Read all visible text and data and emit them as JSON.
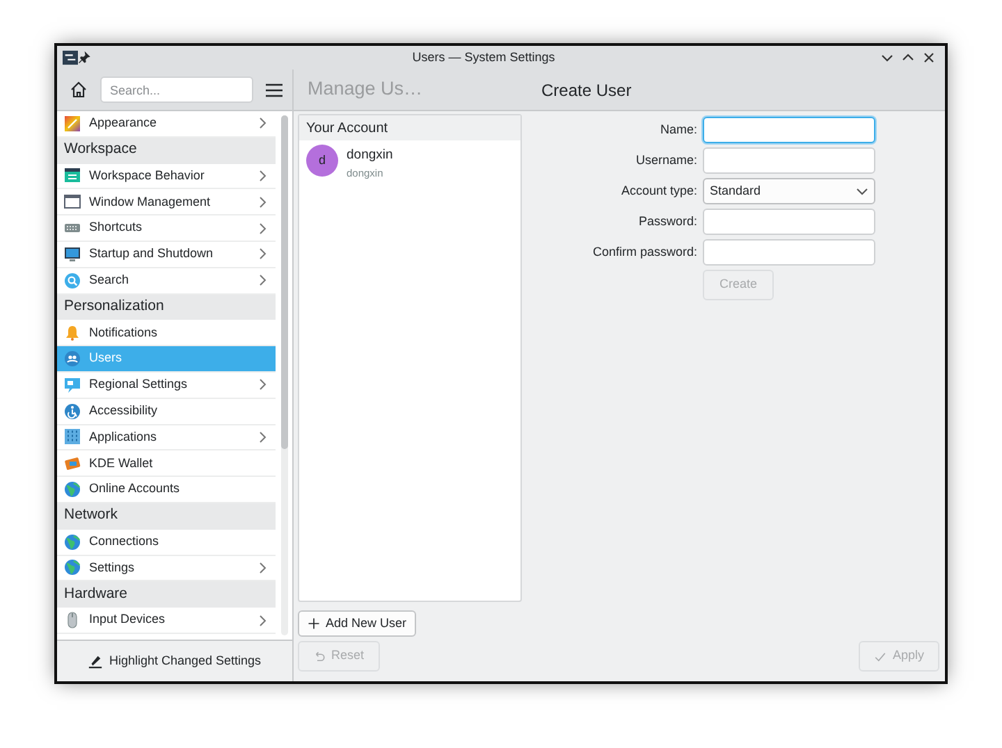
{
  "window": {
    "title": "Users — System Settings"
  },
  "sidebar": {
    "search": {
      "placeholder": "Search..."
    },
    "items": [
      {
        "kind": "item",
        "label": "Appearance",
        "expandable": true,
        "selected": false
      },
      {
        "kind": "header",
        "label": "Workspace"
      },
      {
        "kind": "item",
        "label": "Workspace Behavior",
        "expandable": true,
        "selected": false
      },
      {
        "kind": "item",
        "label": "Window Management",
        "expandable": true,
        "selected": false
      },
      {
        "kind": "item",
        "label": "Shortcuts",
        "expandable": true,
        "selected": false
      },
      {
        "kind": "item",
        "label": "Startup and Shutdown",
        "expandable": true,
        "selected": false
      },
      {
        "kind": "item",
        "label": "Search",
        "expandable": true,
        "selected": false
      },
      {
        "kind": "header",
        "label": "Personalization"
      },
      {
        "kind": "item",
        "label": "Notifications",
        "expandable": false,
        "selected": false
      },
      {
        "kind": "item",
        "label": "Users",
        "expandable": false,
        "selected": true
      },
      {
        "kind": "item",
        "label": "Regional Settings",
        "expandable": true,
        "selected": false
      },
      {
        "kind": "item",
        "label": "Accessibility",
        "expandable": false,
        "selected": false
      },
      {
        "kind": "item",
        "label": "Applications",
        "expandable": true,
        "selected": false
      },
      {
        "kind": "item",
        "label": "KDE Wallet",
        "expandable": false,
        "selected": false
      },
      {
        "kind": "item",
        "label": "Online Accounts",
        "expandable": false,
        "selected": false
      },
      {
        "kind": "header",
        "label": "Network"
      },
      {
        "kind": "item",
        "label": "Connections",
        "expandable": false,
        "selected": false
      },
      {
        "kind": "item",
        "label": "Settings",
        "expandable": true,
        "selected": false
      },
      {
        "kind": "header",
        "label": "Hardware"
      },
      {
        "kind": "item",
        "label": "Input Devices",
        "expandable": true,
        "selected": false
      }
    ],
    "footer_button": "Highlight Changed Settings"
  },
  "page": {
    "breadcrumb": "Manage Us…",
    "title": "Create User",
    "accounts": {
      "heading": "Your Account",
      "users": [
        {
          "avatar_letter": "d",
          "name": "dongxin",
          "username": "dongxin",
          "selected": false
        }
      ]
    },
    "add_button": "Add New User",
    "form": {
      "fields": [
        {
          "kind": "text",
          "label": "Name:",
          "focused": true
        },
        {
          "kind": "text",
          "label": "Username:",
          "focused": false
        },
        {
          "kind": "select",
          "label": "Account type:",
          "value": "Standard",
          "focused": false
        },
        {
          "kind": "text",
          "label": "Password:",
          "focused": false
        },
        {
          "kind": "text",
          "label": "Confirm password:",
          "focused": false
        }
      ],
      "submit": {
        "label": "Create",
        "disabled": true
      }
    }
  },
  "bottom_bar": {
    "reset": {
      "label": "Reset",
      "disabled": true
    },
    "apply": {
      "label": "Apply",
      "disabled": true
    }
  }
}
